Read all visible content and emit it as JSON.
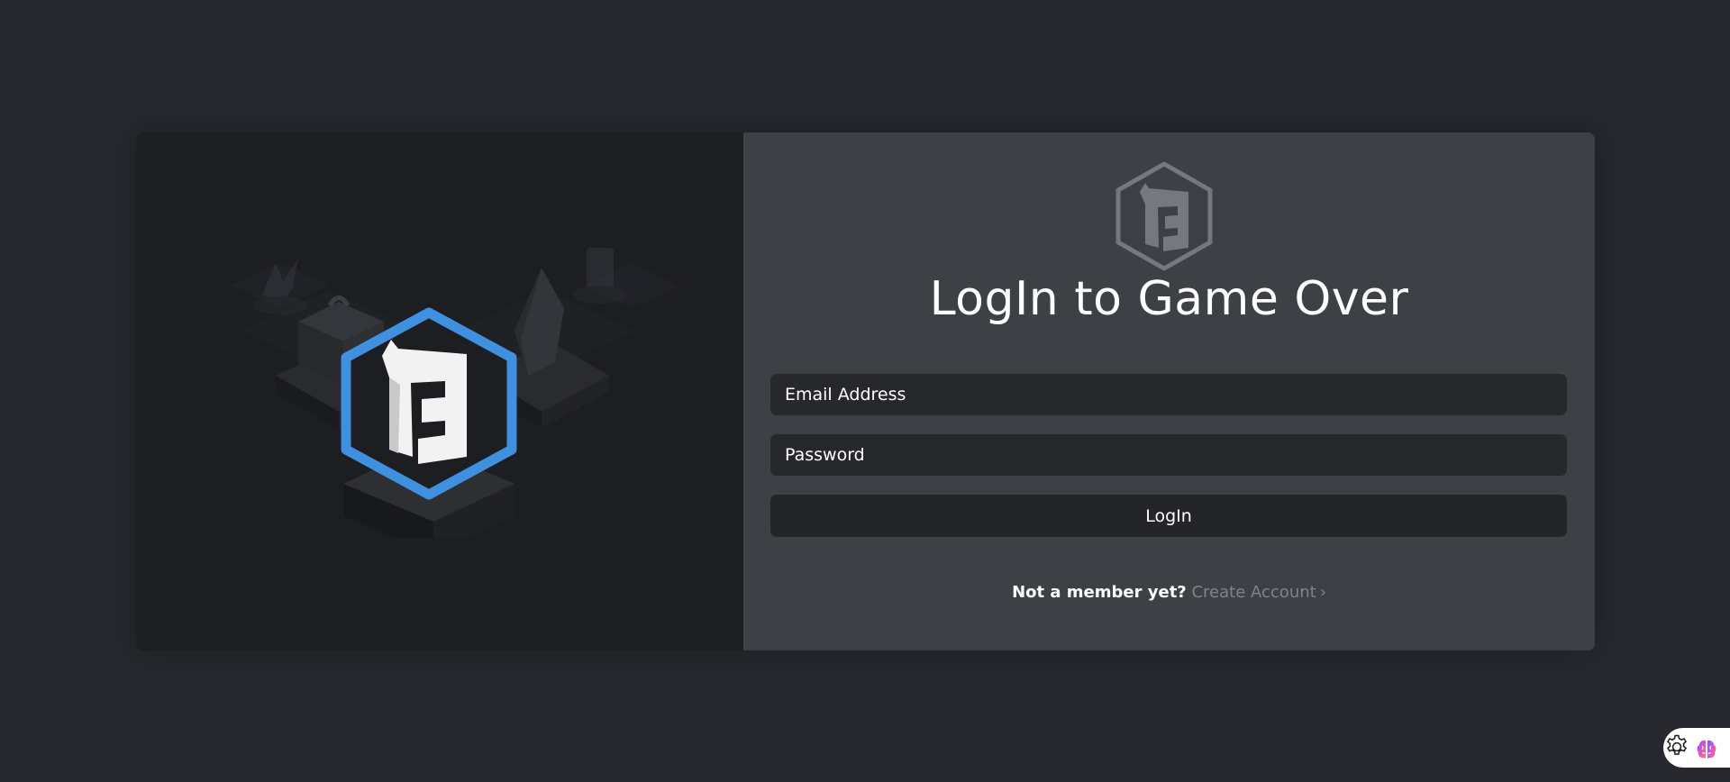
{
  "app": {
    "logo_icon": "game-over-logo-icon"
  },
  "hero": {
    "logo_icon": "game-over-hexagon-logo-icon",
    "accent_color": "#3f91e0"
  },
  "login": {
    "title": "LogIn to Game Over",
    "email_placeholder": "Email Address",
    "email_value": "",
    "password_placeholder": "Password",
    "password_value": "",
    "submit_label": "LogIn"
  },
  "signup": {
    "prompt": "Not a member yet?",
    "link_label": "Create Account",
    "chevron": "›"
  },
  "corner": {
    "settings_icon": "gear-icon",
    "assistant_icon": "brain-icon"
  },
  "colors": {
    "background": "#26282e",
    "left_panel": "#1d1e22",
    "right_panel": "#3d4045",
    "input_bg": "#26282c",
    "link": "#808388"
  }
}
